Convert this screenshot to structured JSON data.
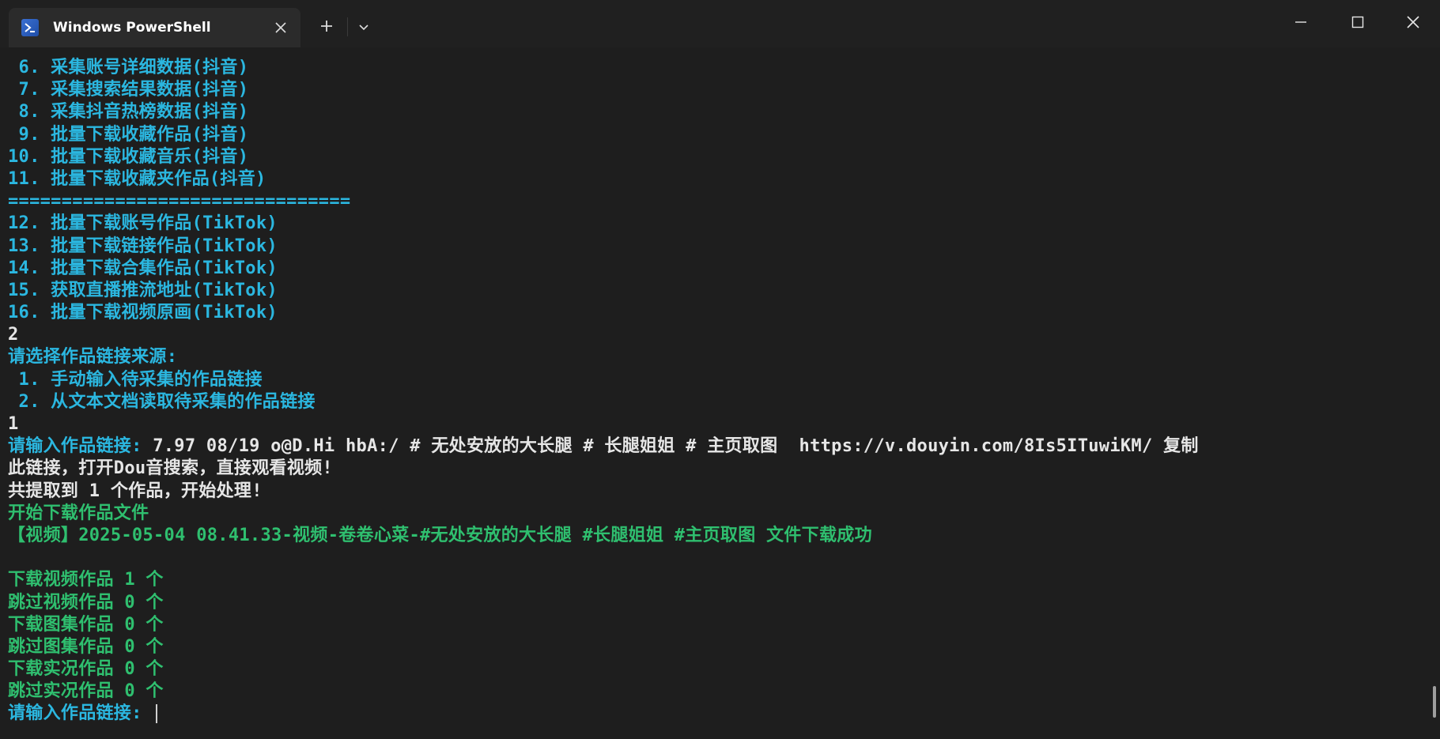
{
  "window": {
    "tab_title": "Windows PowerShell",
    "icons": {
      "tab_icon": "powershell-icon",
      "close": "close-icon",
      "new_tab": "plus-icon",
      "dropdown": "chevron-down-icon",
      "minimize": "minimize-icon",
      "maximize": "maximize-icon",
      "window_close": "close-icon"
    }
  },
  "colors": {
    "menu_text": "#2bb7e0",
    "success_text": "#2fbf6f",
    "plain_text": "#e6e6e6",
    "background": "#1e1e1e"
  },
  "terminal": {
    "lines": [
      {
        "color": "cyan",
        "text": " 6. 采集账号详细数据(抖音)"
      },
      {
        "color": "cyan",
        "text": " 7. 采集搜索结果数据(抖音)"
      },
      {
        "color": "cyan",
        "text": " 8. 采集抖音热榜数据(抖音)"
      },
      {
        "color": "cyan",
        "text": " 9. 批量下载收藏作品(抖音)"
      },
      {
        "color": "cyan",
        "text": "10. 批量下载收藏音乐(抖音)"
      },
      {
        "color": "cyan",
        "text": "11. 批量下载收藏夹作品(抖音)"
      },
      {
        "color": "cyan",
        "text": "================================"
      },
      {
        "color": "cyan",
        "text": "12. 批量下载账号作品(TikTok)"
      },
      {
        "color": "cyan",
        "text": "13. 批量下载链接作品(TikTok)"
      },
      {
        "color": "cyan",
        "text": "14. 批量下载合集作品(TikTok)"
      },
      {
        "color": "cyan",
        "text": "15. 获取直播推流地址(TikTok)"
      },
      {
        "color": "cyan",
        "text": "16. 批量下载视频原画(TikTok)"
      },
      {
        "color": "white",
        "text": "2"
      },
      {
        "color": "cyan",
        "text": "请选择作品链接来源:"
      },
      {
        "color": "cyan",
        "text": " 1. 手动输入待采集的作品链接"
      },
      {
        "color": "cyan",
        "text": " 2. 从文本文档读取待采集的作品链接"
      },
      {
        "color": "white",
        "text": "1"
      },
      {
        "color": "mixed",
        "prompt": "请输入作品链接: ",
        "text": "7.97 08/19 o@D.Hi hbA:/ # 无处安放的大长腿 # 长腿姐姐 # 主页取图  https://v.douyin.com/8Is5ITuwiKM/ 复制"
      },
      {
        "color": "white",
        "text": "此链接，打开Dou音搜索，直接观看视频!"
      },
      {
        "color": "white",
        "text": "共提取到 1 个作品，开始处理!"
      },
      {
        "color": "green",
        "text": "开始下载作品文件"
      },
      {
        "color": "green",
        "text": "【视频】2025-05-04 08.41.33-视频-卷卷心菜-#无处安放的大长腿 #长腿姐姐 #主页取图 文件下载成功"
      },
      {
        "color": "green",
        "text": ""
      },
      {
        "color": "green",
        "text": "下载视频作品 1 个"
      },
      {
        "color": "green",
        "text": "跳过视频作品 0 个"
      },
      {
        "color": "green",
        "text": "下载图集作品 0 个"
      },
      {
        "color": "green",
        "text": "跳过图集作品 0 个"
      },
      {
        "color": "green",
        "text": "下载实况作品 0 个"
      },
      {
        "color": "green",
        "text": "跳过实况作品 0 个"
      }
    ],
    "input_prompt": "请输入作品链接: "
  }
}
